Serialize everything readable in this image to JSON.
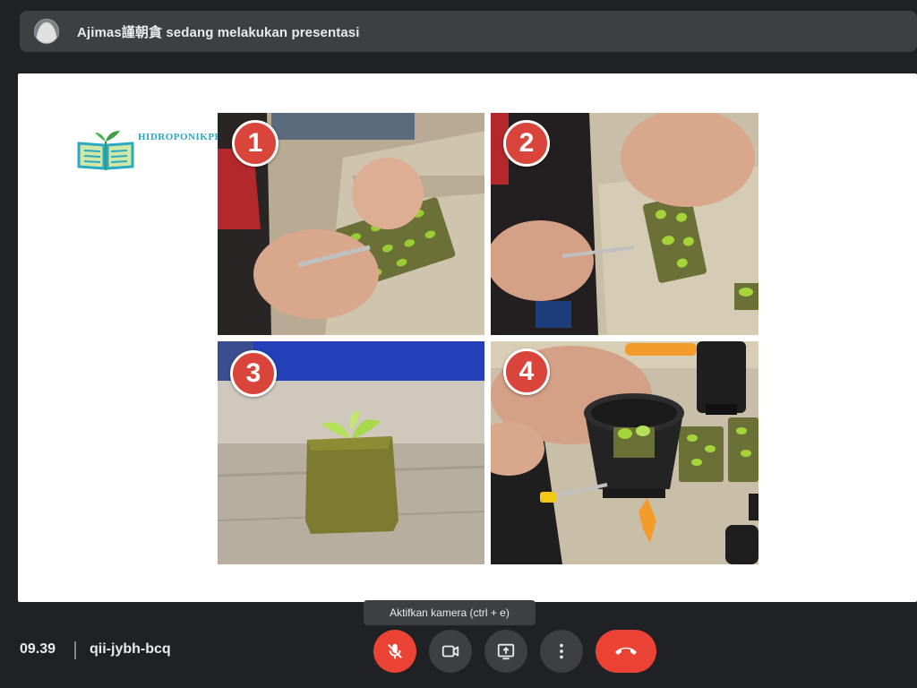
{
  "presenter": {
    "text": "Ajimas謹朝貪 sedang melakukan presentasi"
  },
  "slide": {
    "logo_text": "HIDROPONIKPEDIA",
    "steps": [
      "1",
      "2",
      "3",
      "4"
    ]
  },
  "tooltip": {
    "text": "Aktifkan kamera (ctrl + e)"
  },
  "meeting": {
    "time": "09.39",
    "separator": "|",
    "code": "qii-jybh-bcq"
  },
  "controls": {
    "mic": "mic-off-icon",
    "camera": "camera-off-icon",
    "present": "present-screen-icon",
    "more": "more-options-icon",
    "hangup": "hangup-icon"
  },
  "colors": {
    "background": "#202124",
    "bar": "#3c4043",
    "danger": "#ea4335",
    "badge": "#d9453a"
  }
}
